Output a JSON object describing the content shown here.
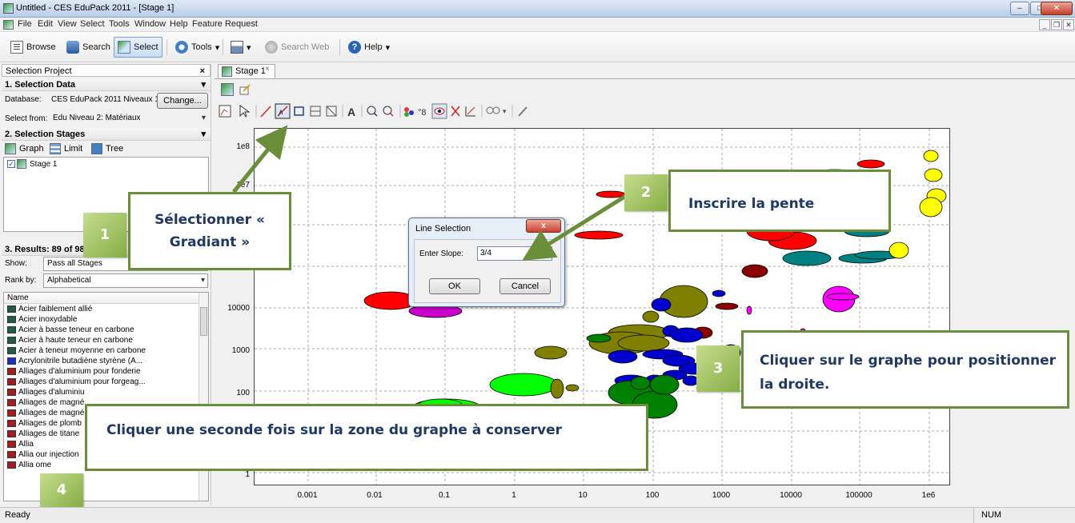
{
  "window": {
    "title": "Untitled - CES EduPack 2011 - [Stage 1]",
    "buttons": {
      "minimize": "–",
      "maximize": "□",
      "close": "✕"
    }
  },
  "menu": {
    "items": [
      "File",
      "Edit",
      "View",
      "Select",
      "Tools",
      "Window",
      "Help",
      "Feature Request"
    ],
    "mdi": {
      "minimize": "_",
      "restore": "❐",
      "close": "✕"
    }
  },
  "toolbar": {
    "browse": "Browse",
    "search": "Search",
    "select": "Select",
    "tools": "Tools",
    "search_web": "Search Web",
    "help": "Help"
  },
  "selection_project": {
    "header": "Selection Project",
    "close": "×",
    "section1": "1. Selection Data",
    "database_label": "Database:",
    "database_value": "CES EduPack 2011 Niveaux 1",
    "change_button": "Change...",
    "select_from_label": "Select from:",
    "select_from_value": "Edu Niveau 2: Matériaux",
    "section2": "2. Selection Stages",
    "stage_tools": [
      "Graph",
      "Limit",
      "Tree"
    ],
    "stages": [
      "Stage 1"
    ],
    "section3": "3. Results: 89 of 98",
    "show_label": "Show:",
    "show_value": "Pass all Stages",
    "rank_label": "Rank by:",
    "rank_value": "Alphabetical",
    "list_header": "Name",
    "results": [
      {
        "name": "Acier faiblement allié",
        "color": "#1f5d4a"
      },
      {
        "name": "Acier inoxydable",
        "color": "#1f5d4a"
      },
      {
        "name": "Acier à basse teneur en carbone",
        "color": "#1f5d4a"
      },
      {
        "name": "Acier à haute teneur en carbone",
        "color": "#1f5d4a"
      },
      {
        "name": "Acier à teneur moyenne en carbone",
        "color": "#1f5d4a"
      },
      {
        "name": "Acrylonitrile butadiène styrène (A...",
        "color": "#1b2fc8"
      },
      {
        "name": "Alliages d'aluminium pour fonderie",
        "color": "#a61b1b"
      },
      {
        "name": "Alliages d'aluminium pour forgeag...",
        "color": "#a61b1b"
      },
      {
        "name": "Alliages d'aluminiu",
        "color": "#a61b1b"
      },
      {
        "name": "Alliages de magné",
        "color": "#a61b1b"
      },
      {
        "name": "Alliages de magné",
        "color": "#a61b1b"
      },
      {
        "name": "Alliages de plomb",
        "color": "#a61b1b"
      },
      {
        "name": "Alliages de titane",
        "color": "#a61b1b"
      },
      {
        "name": "Allia",
        "color": "#a61b1b"
      },
      {
        "name": "Allia                     our injection",
        "color": "#a61b1b"
      },
      {
        "name": "Allia                     ome",
        "color": "#a61b1b"
      }
    ]
  },
  "stage_tab": {
    "label": "Stage 1",
    "close": "×"
  },
  "chart_data": {
    "type": "scatter",
    "title": "",
    "xlabel": "",
    "ylabel": "",
    "x_scale": "log",
    "y_scale": "log",
    "x_ticks": [
      "0.001",
      "0.01",
      "0.1",
      "1",
      "10",
      "100",
      "1000",
      "10000",
      "100000",
      "1e6"
    ],
    "y_ticks": [
      "1e8",
      "1e7",
      "10000",
      "1000",
      "100",
      "1"
    ],
    "grid": true
  },
  "dialog": {
    "title": "Line Selection",
    "close": "x",
    "slope_label": "Enter Slope:",
    "slope_value": "3/4",
    "ok": "OK",
    "cancel": "Cancel"
  },
  "annotations": {
    "step1_num": "1",
    "step1_text": "Sélectionner « Gradiant »",
    "step2_num": "2",
    "step2_text": "Inscrire la pente",
    "step3_num": "3",
    "step3_text": "Cliquer sur le graphe pour positionner la droite.",
    "step4_num": "4",
    "step4_text": "Cliquer une seconde fois sur la zone du graphe à conserver"
  },
  "status": {
    "left": "Ready",
    "right": "NUM"
  }
}
